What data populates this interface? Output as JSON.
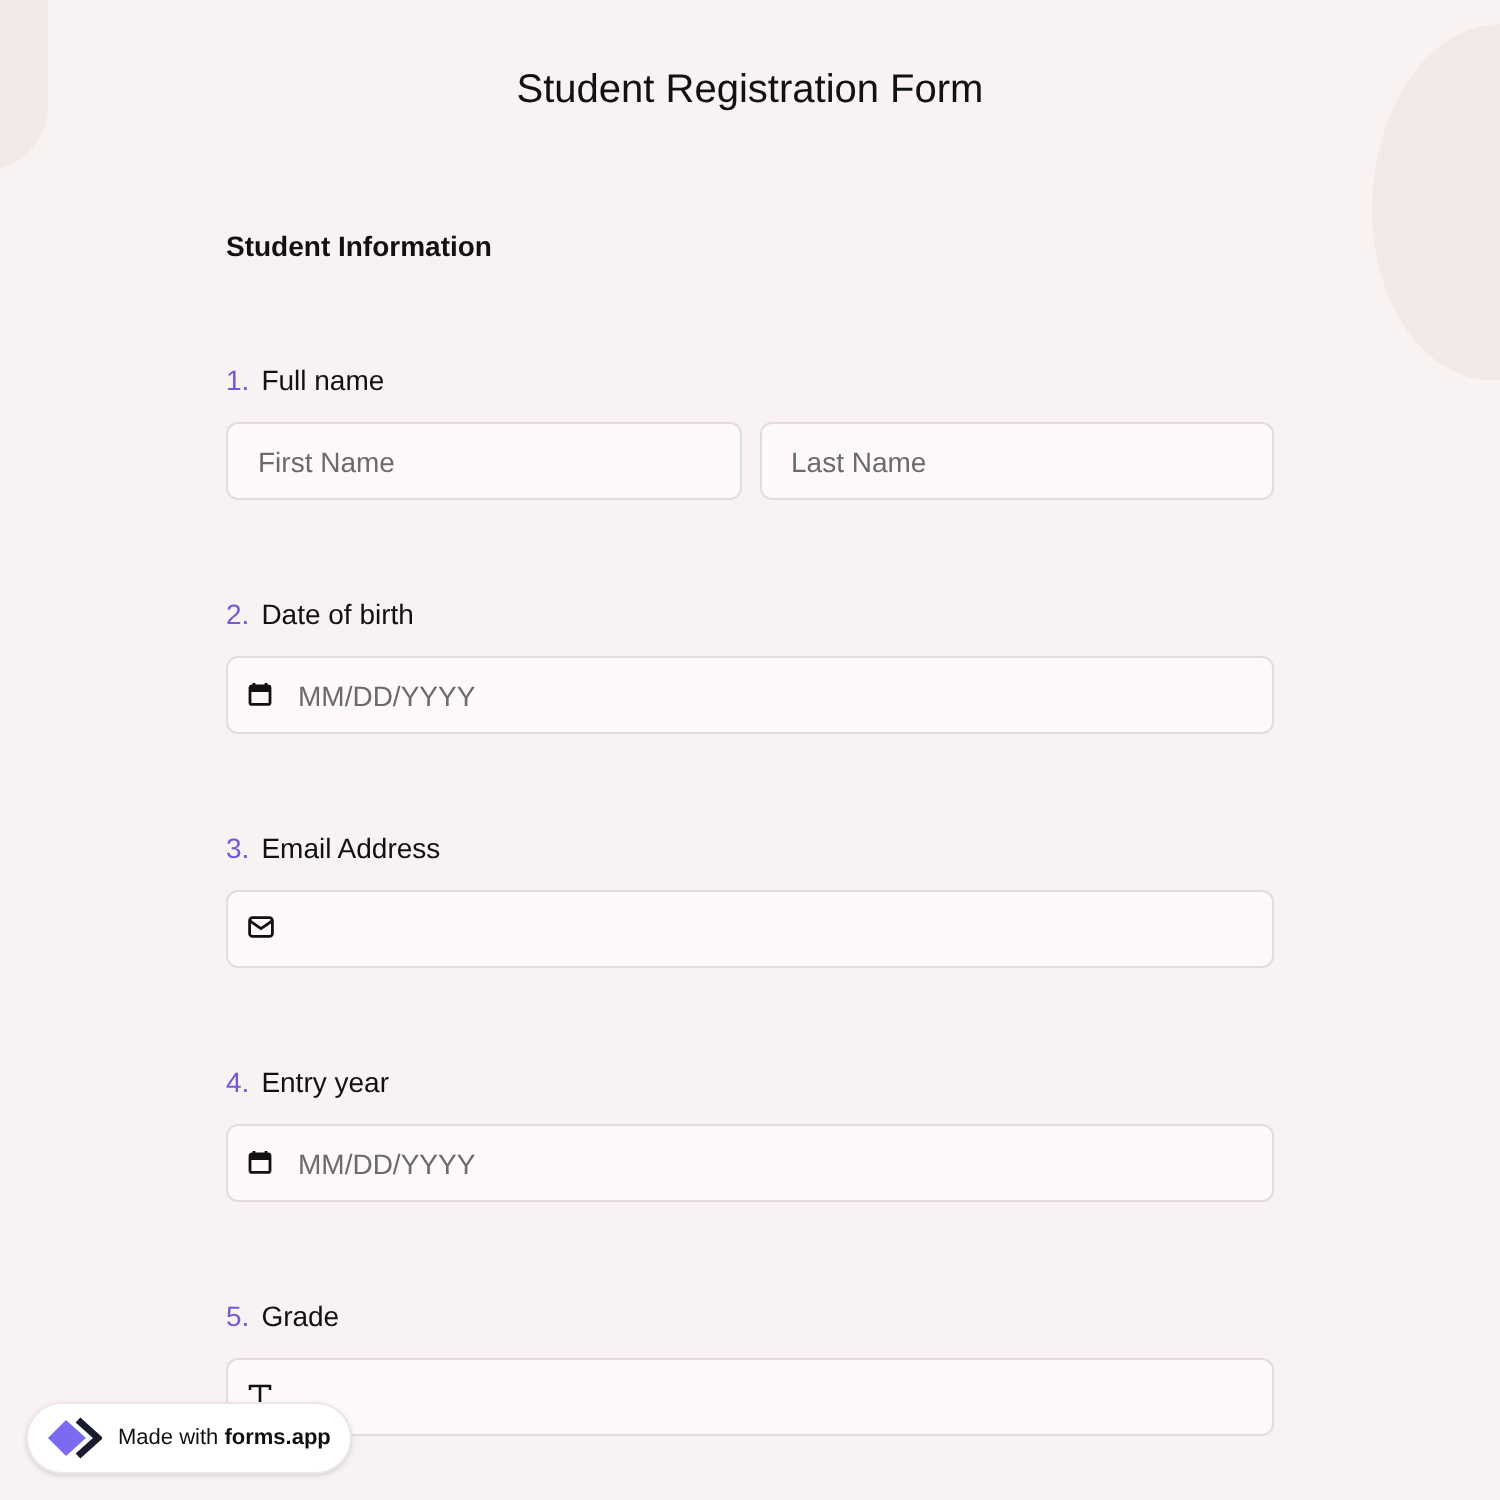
{
  "title": "Student Registration Form",
  "section": {
    "title": "Student Information"
  },
  "questions": [
    {
      "number": "1.",
      "label": "Full name",
      "kind": "name",
      "fields": [
        {
          "placeholder": "First Name"
        },
        {
          "placeholder": "Last Name"
        }
      ]
    },
    {
      "number": "2.",
      "label": "Date of birth",
      "kind": "date",
      "placeholder": "MM/DD/YYYY"
    },
    {
      "number": "3.",
      "label": "Email Address",
      "kind": "email"
    },
    {
      "number": "4.",
      "label": "Entry year",
      "kind": "date",
      "placeholder": "MM/DD/YYYY"
    },
    {
      "number": "5.",
      "label": "Grade",
      "kind": "text"
    }
  ],
  "badge": {
    "text": "Made with **forms.app**"
  }
}
